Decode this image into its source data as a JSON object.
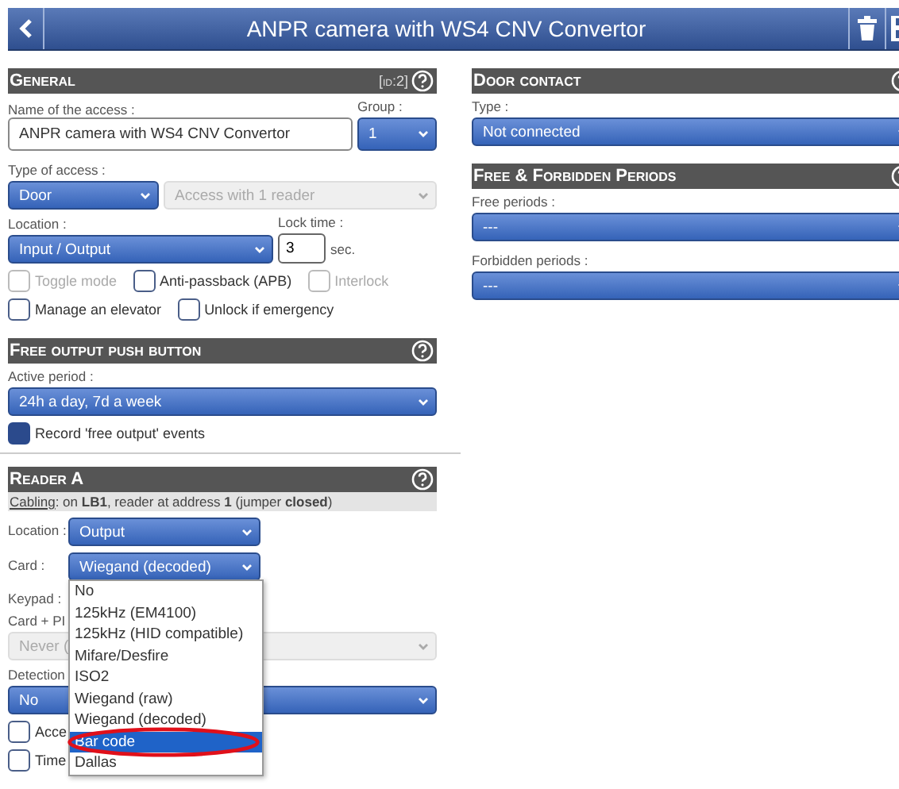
{
  "header": {
    "title": "ANPR camera with WS4 CNV Convertor"
  },
  "general": {
    "title": "General",
    "id_badge": "[id:2]",
    "name_label": "Name of the access :",
    "name_value": "ANPR camera with WS4 CNV Convertor",
    "group_label": "Group :",
    "group_value": "1",
    "type_label": "Type of access :",
    "type_value": "Door",
    "mode_value": "Access with 1 reader",
    "mode_disabled": true,
    "location_label": "Location :",
    "location_value": "Input / Output",
    "lock_label": "Lock time :",
    "lock_value": "3",
    "lock_unit": "sec.",
    "checkbox_rows": [
      [
        {
          "label": "Toggle mode",
          "checked": false,
          "disabled": true
        },
        {
          "label": "Anti-passback (APB)",
          "checked": false,
          "disabled": false
        },
        {
          "label": "Interlock",
          "checked": false,
          "disabled": true
        }
      ],
      [
        {
          "label": "Manage an elevator",
          "checked": false,
          "disabled": false
        },
        {
          "label": "Unlock if emergency",
          "checked": false,
          "disabled": false
        }
      ]
    ]
  },
  "door_contact": {
    "title": "Door contact",
    "type_label": "Type :",
    "type_value": "Not connected"
  },
  "periods": {
    "title": "Free & Forbidden Periods",
    "free_label": "Free periods :",
    "free_value": "---",
    "forbidden_label": "Forbidden periods :",
    "forbidden_value": "---"
  },
  "free_output": {
    "title": "Free output push button",
    "period_label": "Active period :",
    "period_value": "24h a day, 7d a week",
    "record": {
      "label": "Record 'free output' events",
      "checked": true,
      "disabled": false
    }
  },
  "reader_a": {
    "title": "Reader A",
    "cabling_link": "Cabling",
    "cabling_text": ": on **LB1**, reader at address **1** (jumper **closed**)",
    "location_label": "Location :",
    "location_value": "Output",
    "card_label": "Card :",
    "card_value": "Wiegand (decoded)",
    "card_options": [
      {
        "label": "No",
        "selected": false
      },
      {
        "label": "125kHz (EM4100)",
        "selected": false
      },
      {
        "label": "125kHz (HID compatible)",
        "selected": false
      },
      {
        "label": "Mifare/Desfire",
        "selected": false
      },
      {
        "label": "ISO2",
        "selected": false
      },
      {
        "label": "Wiegand (raw)",
        "selected": false
      },
      {
        "label": "Wiegand (decoded)",
        "selected": false
      },
      {
        "label": "Bar code",
        "selected": true
      },
      {
        "label": "Dallas",
        "selected": false
      }
    ],
    "keypad_label": "Keypad :",
    "pin_label": "Card + PI",
    "pin_value": "Never (",
    "pin_disabled": true,
    "detection_label": "Detection",
    "detection_value": "No",
    "checkboxes": [
      {
        "label": "Acce",
        "checked": false,
        "disabled": false
      },
      {
        "label": "Time",
        "checked": false,
        "disabled": false
      }
    ]
  }
}
